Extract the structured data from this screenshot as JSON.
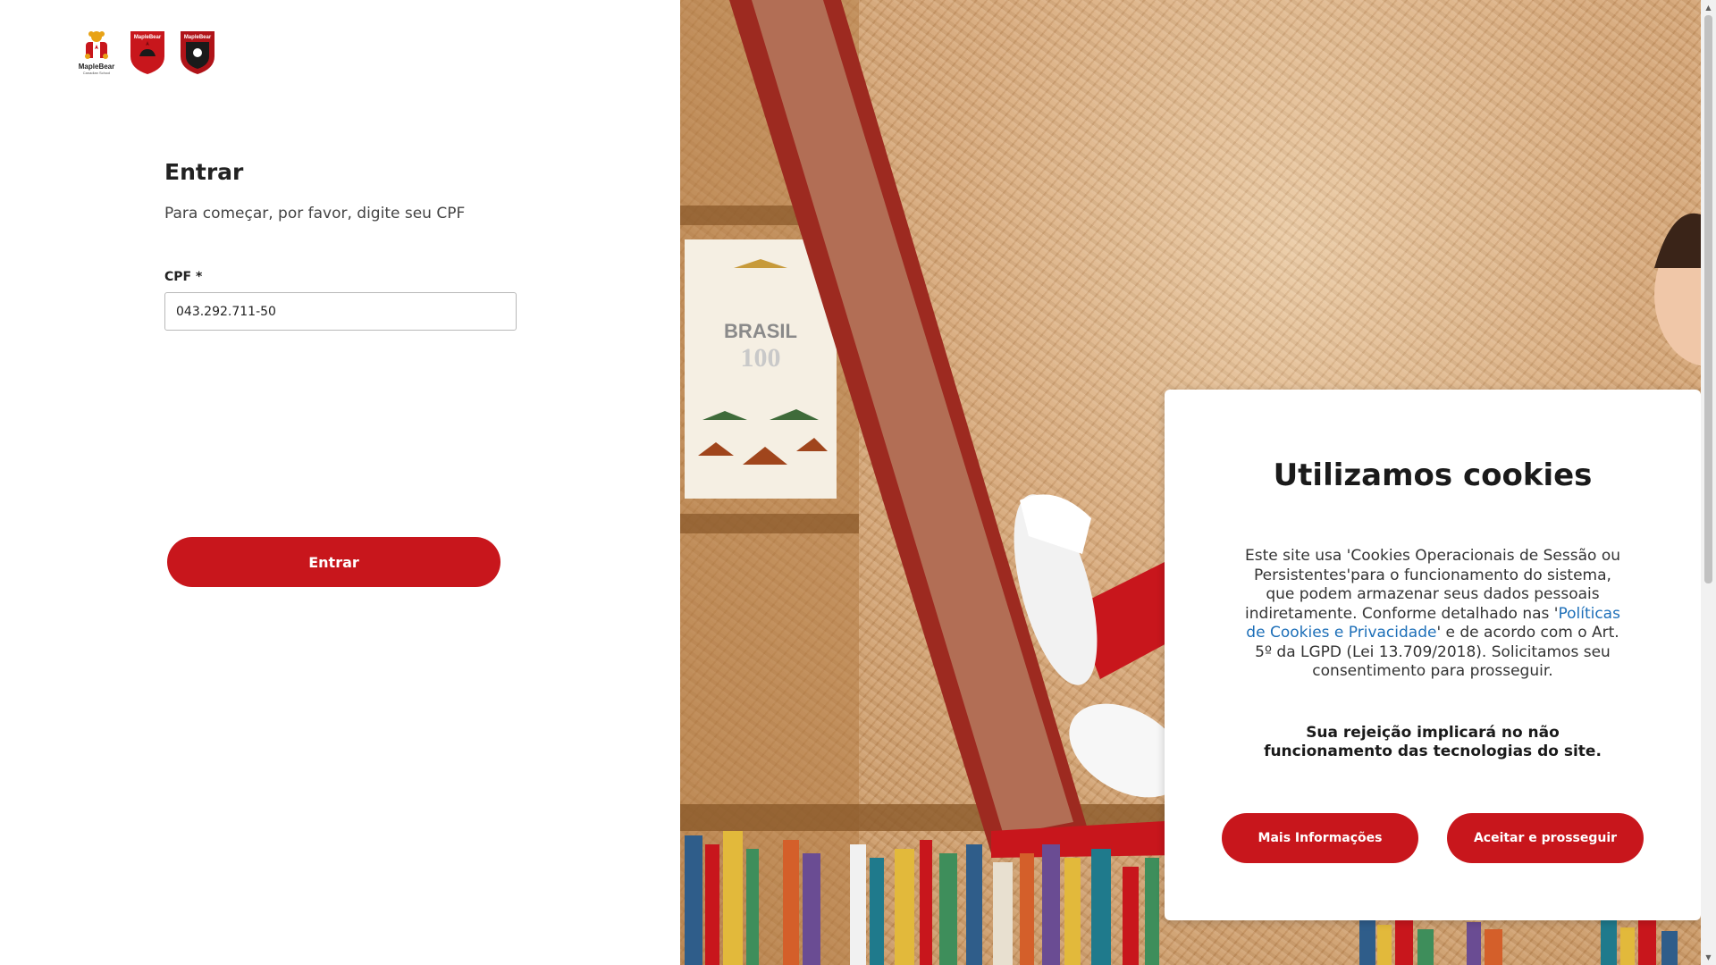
{
  "login": {
    "title": "Entrar",
    "subtitle": "Para começar, por favor, digite seu CPF",
    "cpf_label": "CPF *",
    "cpf_value": "043.292.711-50",
    "submit_label": "Entrar"
  },
  "logos": [
    {
      "name": "maple-bear-canadian-school-logo",
      "text": "MapleBear",
      "subtext": "Canadian School"
    },
    {
      "name": "maple-bear-red-shield-logo",
      "text": "MapleBear"
    },
    {
      "name": "maple-bear-dark-shield-logo",
      "text": "MapleBear"
    }
  ],
  "hero": {
    "book_title": "BRASIL",
    "book_number": "100"
  },
  "cookies": {
    "title": "Utilizamos cookies",
    "text_before_link": "Este site usa 'Cookies Operacionais de Sessão ou Persistentes'para o funcionamento do sistema, que podem armazenar seus dados pessoais indiretamente. Conforme detalhado nas '",
    "link_text": "Políticas de Cookies e Privacidade",
    "text_after_link": "' e de acordo com o Art. 5º da LGPD (Lei 13.709/2018). Solicitamos seu consentimento para prosseguir.",
    "warning": "Sua rejeição implicará no não funcionamento das tecnologias do site.",
    "more_info_label": "Mais Informações",
    "accept_label": "Aceitar e prosseguir"
  },
  "colors": {
    "brand_red": "#c8161c",
    "link_blue": "#1d6fb8"
  },
  "icons": {
    "scroll_up": "▲",
    "scroll_down": "▼"
  }
}
